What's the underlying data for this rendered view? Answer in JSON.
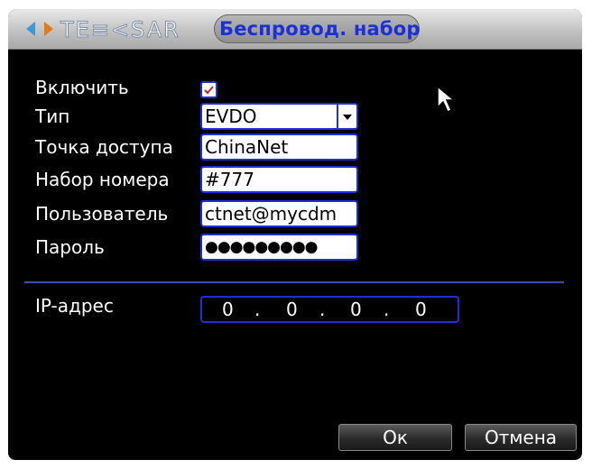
{
  "dialog": {
    "brand": "TE≡<SAR",
    "title": "Беспровод. набор"
  },
  "form": {
    "enable_label": "Включить",
    "enable_checked": true,
    "type_label": "Тип",
    "type_value": "EVDO",
    "apn_label": "Точка доступа",
    "apn_value": "ChinaNet",
    "dial_label": "Набор номера",
    "dial_value": "#777",
    "user_label": "Пользователь",
    "user_value": "ctnet@mycdm",
    "password_label": "Пароль",
    "password_value": "●●●●●●●●●",
    "ip_label": "IP-адрес",
    "ip_octets": [
      "0",
      "0",
      "0",
      "0"
    ],
    "ip_dots": [
      ".",
      ".",
      "."
    ]
  },
  "buttons": {
    "ok": "Ок",
    "cancel": "Отмена"
  },
  "colors": {
    "accent": "#1d2fd6",
    "background": "#000000",
    "text": "#ffffff"
  }
}
